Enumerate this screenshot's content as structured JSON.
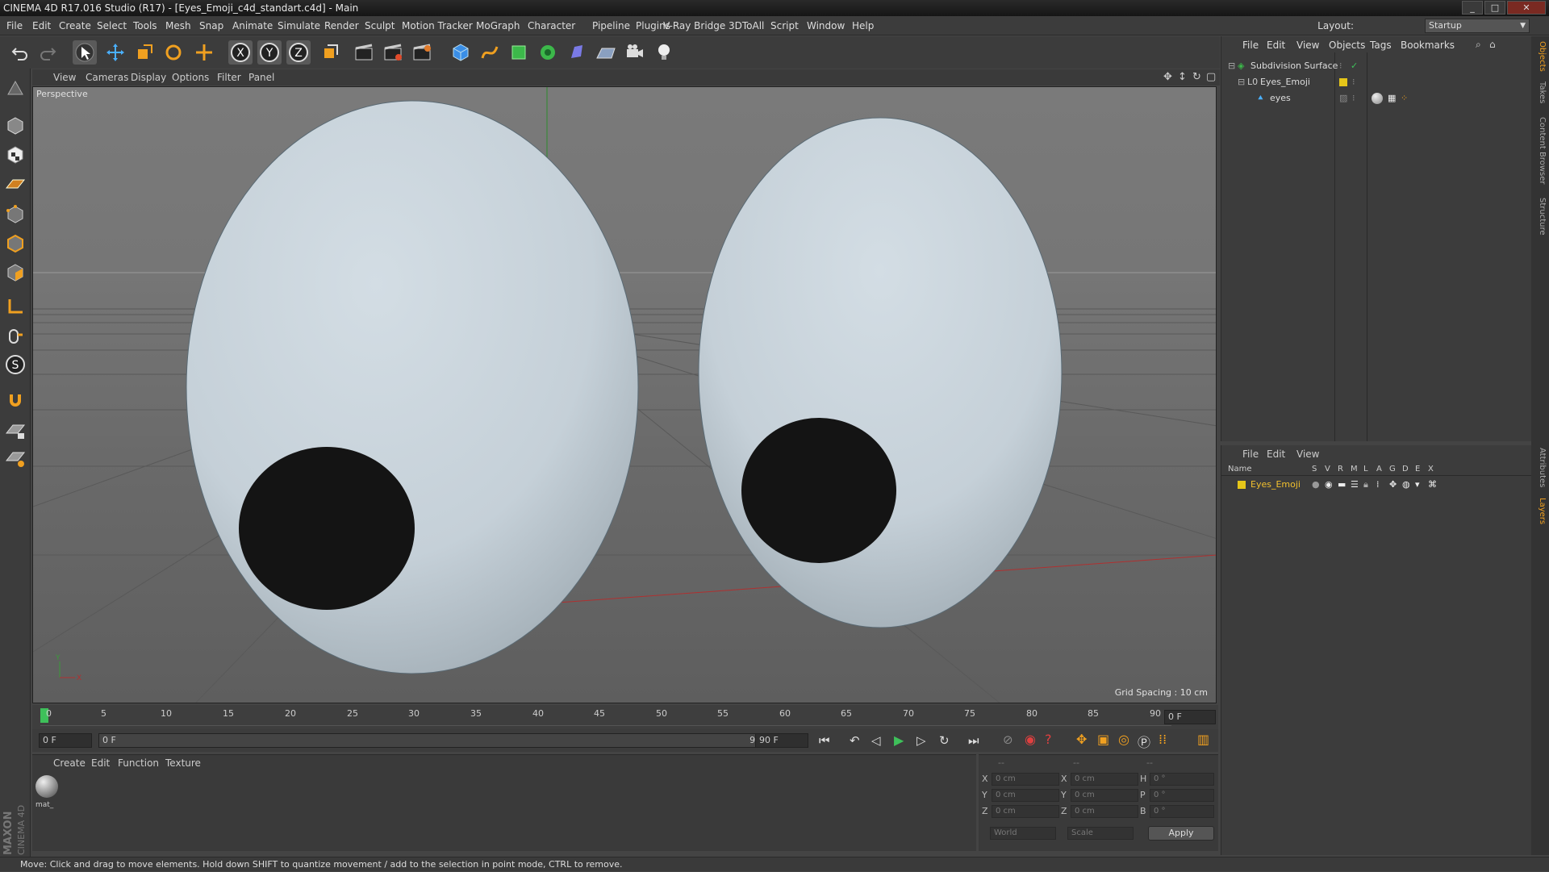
{
  "window": {
    "title": "CINEMA 4D R17.016 Studio (R17) - [Eyes_Emoji_c4d_standart.c4d] - Main"
  },
  "menu": [
    "File",
    "Edit",
    "Create",
    "Select",
    "Tools",
    "Mesh",
    "Snap",
    "Animate",
    "Simulate",
    "Render",
    "Sculpt",
    "Motion Tracker",
    "MoGraph",
    "Character",
    "Pipeline",
    "Plugins",
    "V-Ray Bridge",
    "3DToAll",
    "Script",
    "Window",
    "Help"
  ],
  "layout": {
    "label": "Layout:",
    "value": "Startup"
  },
  "viewport": {
    "menu": [
      "View",
      "Cameras",
      "Display",
      "Options",
      "Filter",
      "Panel"
    ],
    "label": "Perspective",
    "grid_spacing": "Grid Spacing : 10 cm"
  },
  "timeline": {
    "ticks": [
      "0",
      "5",
      "10",
      "15",
      "20",
      "25",
      "30",
      "35",
      "40",
      "45",
      "50",
      "55",
      "60",
      "65",
      "70",
      "75",
      "80",
      "85",
      "90"
    ],
    "current_frame": "0 F",
    "start_field": "0 F",
    "range_start": "0 F",
    "range_end": "90 F",
    "end_field": "90 F"
  },
  "material_panel": {
    "menu": [
      "Create",
      "Edit",
      "Function",
      "Texture"
    ],
    "material_name": "mat_"
  },
  "coords": {
    "headers": [
      "--",
      "--",
      "--"
    ],
    "rows": [
      {
        "a": "X",
        "av": "0 cm",
        "b": "X",
        "bv": "0 cm",
        "c": "H",
        "cv": "0 °"
      },
      {
        "a": "Y",
        "av": "0 cm",
        "b": "Y",
        "bv": "0 cm",
        "c": "P",
        "cv": "0 °"
      },
      {
        "a": "Z",
        "av": "0 cm",
        "b": "Z",
        "bv": "0 cm",
        "c": "B",
        "cv": "0 °"
      }
    ],
    "world": "World",
    "scale": "Scale",
    "apply": "Apply"
  },
  "object_manager": {
    "menu": [
      "File",
      "Edit",
      "View",
      "Objects",
      "Tags",
      "Bookmarks"
    ],
    "objects": [
      "Subdivision Surface",
      "Eyes_Emoji",
      "eyes"
    ]
  },
  "layer_manager": {
    "menu": [
      "File",
      "Edit",
      "View"
    ],
    "columns": [
      "Name",
      "S",
      "V",
      "R",
      "M",
      "L",
      "A",
      "G",
      "D",
      "E",
      "X"
    ],
    "layers": [
      "Eyes_Emoji"
    ]
  },
  "right_tabs": [
    "Objects",
    "Takes",
    "Content Browser",
    "Structure",
    "Attributes",
    "Layers"
  ],
  "status": "Move: Click and drag to move elements. Hold down SHIFT to quantize movement / add to the selection in point mode, CTRL to remove.",
  "colors": {
    "accent": "#f2c12e",
    "layer": "#e6c619",
    "eye_white": "#c9d4dc",
    "pupil": "#141414"
  }
}
